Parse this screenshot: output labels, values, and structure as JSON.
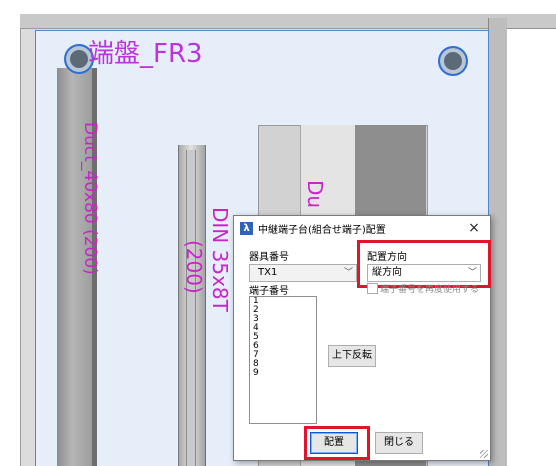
{
  "cad": {
    "title_label": "端盤_FR3",
    "duct_left_label": "Duct_40x80 (200)",
    "din_label": "DIN 35x8T",
    "din_sub_label": "(200)",
    "duct_right_label": "Du"
  },
  "dialog": {
    "title": "中継端子台(組合せ端子)配置",
    "close_label": "×",
    "device_number_label": "器具番号",
    "device_number_value": "TX1",
    "placement_direction_label": "配置方向",
    "placement_direction_value": "縦方向",
    "reuse_terminal_label": "端子番号を再度使用する",
    "terminal_number_label": "端子番号",
    "terminal_numbers": [
      "1",
      "2",
      "3",
      "4",
      "5",
      "6",
      "7",
      "8",
      "9"
    ],
    "flip_button": "上下反転",
    "place_button": "配置",
    "close_button": "閉じる"
  },
  "colors": {
    "label_magenta": "#cc22cc",
    "highlight_red": "#e0142a",
    "selection_blue": "#2f6fd6"
  },
  "icons": {
    "app": "app-logo-icon",
    "dropdown": "chevron-down-icon",
    "close": "close-icon"
  }
}
